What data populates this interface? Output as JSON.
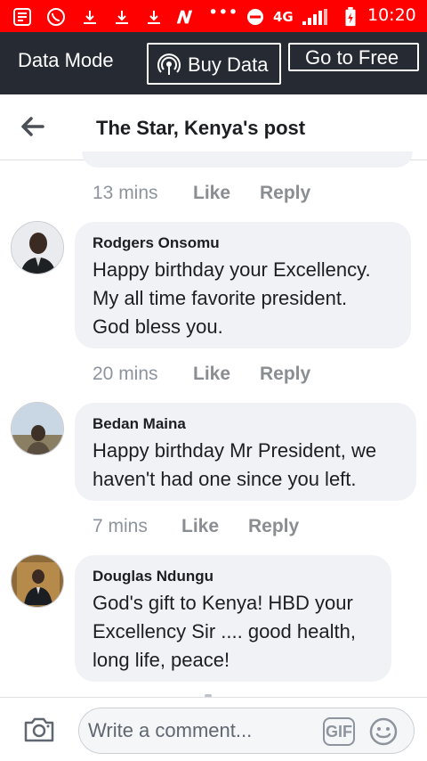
{
  "status_bar": {
    "network": "4G",
    "time": "10:20"
  },
  "data_bar": {
    "mode_label": "Data Mode",
    "buy_label": "Buy Data",
    "free_label": "Go to Free"
  },
  "header": {
    "title": "The Star, Kenya's post"
  },
  "comments": [
    {
      "time": "13 mins",
      "like": "Like",
      "reply": "Reply"
    },
    {
      "author": "Rodgers Onsomu",
      "lines": [
        "Happy birthday your Excellency.",
        "My all time favorite president.",
        "God bless you."
      ],
      "time": "20 mins",
      "like": "Like",
      "reply": "Reply"
    },
    {
      "author": "Bedan Maina",
      "lines": [
        "Happy birthday Mr President, we",
        "haven't had one since you left."
      ],
      "time": "7 mins",
      "like": "Like",
      "reply": "Reply"
    },
    {
      "author": "Douglas Ndungu",
      "lines": [
        "God's gift to Kenya! HBD your",
        "Excellency Sir .... good health,",
        "long life, peace!"
      ]
    }
  ],
  "composer": {
    "placeholder": "Write a comment...",
    "gif_label": "GIF"
  },
  "colors": {
    "status_red": "#ff0000",
    "data_bar_bg": "#252a33",
    "bubble_bg": "#f0f2f5",
    "meta_gray": "#8d949e"
  },
  "icons": [
    "back-arrow-icon",
    "broadcast-icon",
    "camera-icon",
    "gif-icon",
    "smiley-icon"
  ]
}
